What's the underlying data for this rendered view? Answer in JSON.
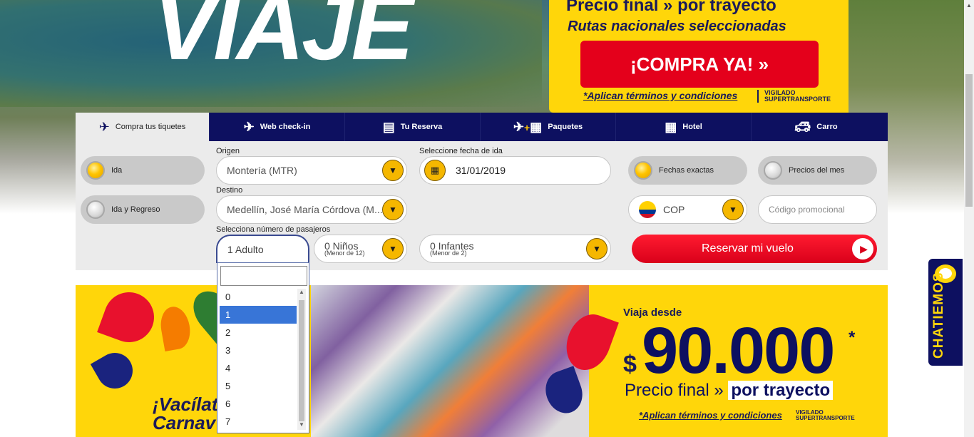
{
  "hero": {
    "headline": "VIAJE",
    "promo_line1_a": "Precio final » ",
    "promo_line1_b": "por trayecto",
    "promo_line2": "Rutas nacionales seleccionadas",
    "cta": "¡COMPRA YA!  »",
    "terms": "*Aplican términos y condiciones",
    "vigilado": "VIGILADO SUPERTRANSPORTE"
  },
  "tabs": [
    {
      "label": "Compra tus tiquetes",
      "icon": "plane-cloud-icon"
    },
    {
      "label": "Web check-in",
      "icon": "plane-cloud-icon"
    },
    {
      "label": "Tu Reserva",
      "icon": "ticket-icon"
    },
    {
      "label": "Paquetes",
      "icon": "plane-hotel-icon"
    },
    {
      "label": "Hotel",
      "icon": "building-icon"
    },
    {
      "label": "Carro",
      "icon": "car-icon"
    }
  ],
  "trip_type": {
    "ida": "Ida",
    "ida_regreso": "Ida y Regreso"
  },
  "origin": {
    "label": "Origen",
    "value": "Montería (MTR)"
  },
  "destination": {
    "label": "Destino",
    "value": "Medellín, José María Córdova (M..."
  },
  "date": {
    "label": "Seleccione fecha de ida",
    "value": "31/01/2019"
  },
  "passengers": {
    "label": "Selecciona número de pasajeros",
    "adults": "1 Adulto",
    "children": "0 Niños",
    "children_note": "(Menor de 12)",
    "infants": "0 Infantes",
    "infants_note": "(Menor de 2)"
  },
  "options": {
    "exact": "Fechas exactas",
    "month": "Precios del mes"
  },
  "currency": "COP",
  "promo_code": {
    "placeholder": "Código promocional"
  },
  "reserve_button": "Reservar mi vuelo",
  "dropdown": {
    "search_value": "",
    "items": [
      "0",
      "1",
      "2",
      "3",
      "4",
      "5",
      "6",
      "7"
    ],
    "selected": "1"
  },
  "carnival": {
    "headline": "¡Vacílat\nCarnav",
    "viaja": "Viaja desde",
    "dollar": "$",
    "price": "90.000",
    "star": "*",
    "pf_a": "Precio final » ",
    "pf_b": "por trayecto",
    "terms": "*Aplican términos y condiciones",
    "vigilado": "VIGILADO SUPERTRANSPORTE"
  },
  "chat": "CHATIEMOS"
}
